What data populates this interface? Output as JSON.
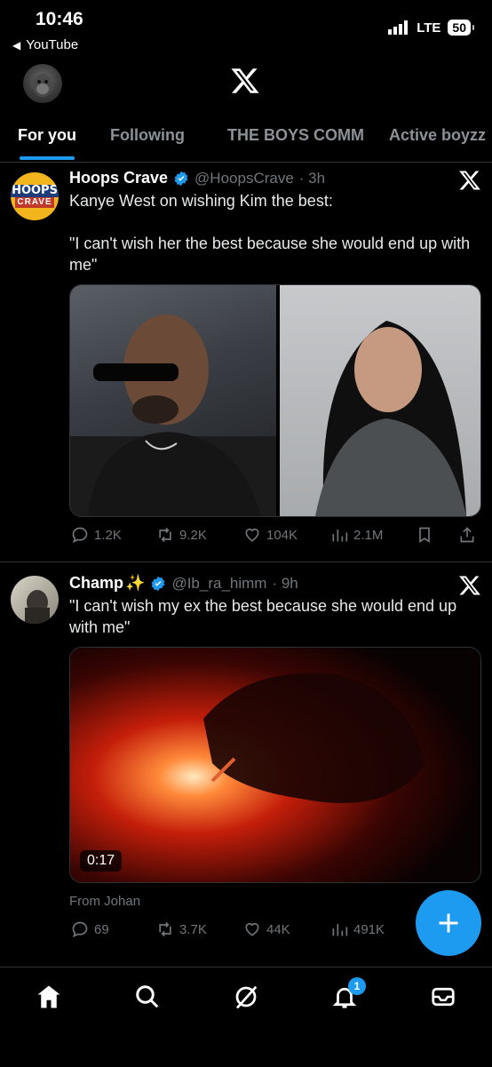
{
  "status_bar": {
    "time": "10:46",
    "back_app": "YouTube",
    "network": "LTE",
    "battery": "50"
  },
  "tabs": [
    "For you",
    "Following",
    "THE BOYS COMM",
    "Active boyzz"
  ],
  "tweets": [
    {
      "name": "Hoops Crave",
      "handle": "@HoopsCrave",
      "time": "· 3h",
      "avatar_text_top": "HOOPS",
      "avatar_text_bottom": "CRAVE",
      "text": "Kanye West on wishing Kim the best:\n\n\"I can't wish her the best because she would end up with me\"",
      "replies": "1.2K",
      "retweets": "9.2K",
      "likes": "104K",
      "views": "2.1M"
    },
    {
      "name": "Champ",
      "name_emoji": "✨",
      "handle": "@Ib_ra_himm",
      "time": "· 9h",
      "text": "\"I can't wish my ex the best because she would end up with me\"",
      "video_duration": "0:17",
      "from": "From Johan",
      "replies": "69",
      "retweets": "3.7K",
      "likes": "44K",
      "views": "491K"
    }
  ],
  "notifications_badge": "1",
  "colors": {
    "accent": "#1d9bf0",
    "background": "#000000",
    "muted": "#71767b"
  }
}
